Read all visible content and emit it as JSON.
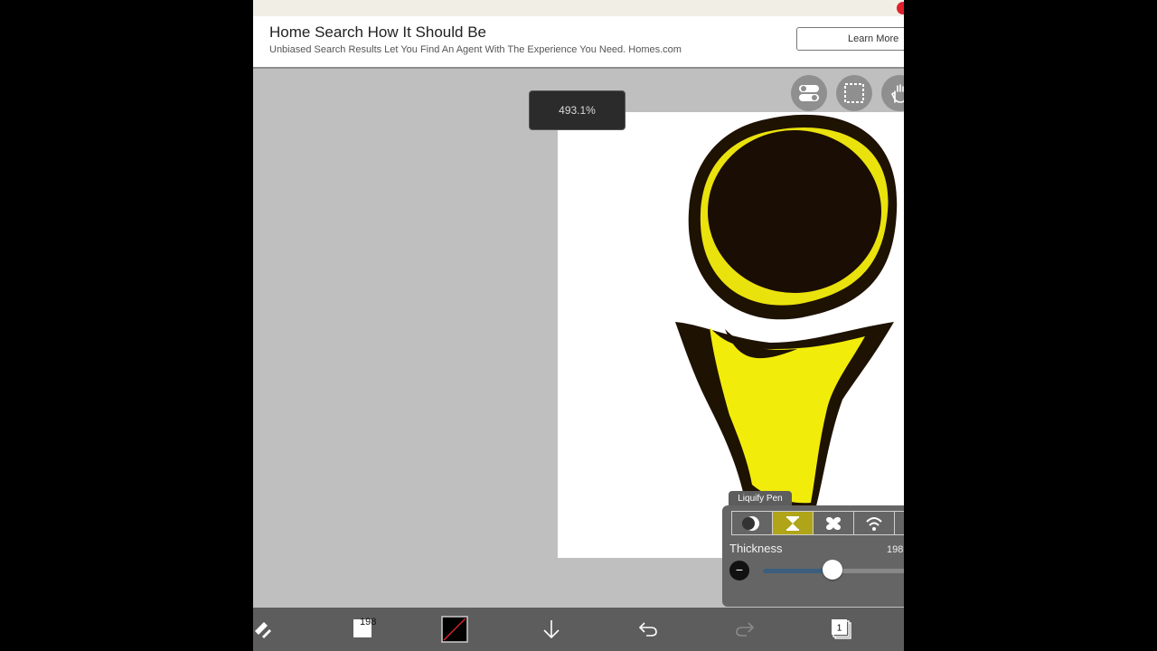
{
  "ad": {
    "title": "Home Search How It Should Be",
    "subtitle": "Unbiased Search Results Let You Find An Agent With The Experience You Need. Homes.com",
    "button": "Learn More"
  },
  "canvas": {
    "zoom": "493.1%"
  },
  "top_tools": [
    "toggle-icon",
    "selection-icon",
    "hand-icon"
  ],
  "liquify": {
    "tab_label": "Liquify Pen",
    "modes": [
      "push-icon",
      "pinch-icon",
      "expand-icon",
      "wave-icon"
    ],
    "active_mode": 1,
    "thickness_label": "Thickness",
    "thickness_value": "198",
    "thickness_fraction": 0.45
  },
  "toolbar": {
    "brush_size": "198",
    "icons": [
      "edit-tools-icon",
      "brush-size-icon",
      "color-swatch-icon",
      "import-icon",
      "undo-icon",
      "redo-icon",
      "layers-icon"
    ],
    "layer_count": "1"
  },
  "colors": {
    "accent": "#b0a419",
    "slider": "#3c5e7e",
    "drawing_yellow": "#f2ec0a"
  }
}
